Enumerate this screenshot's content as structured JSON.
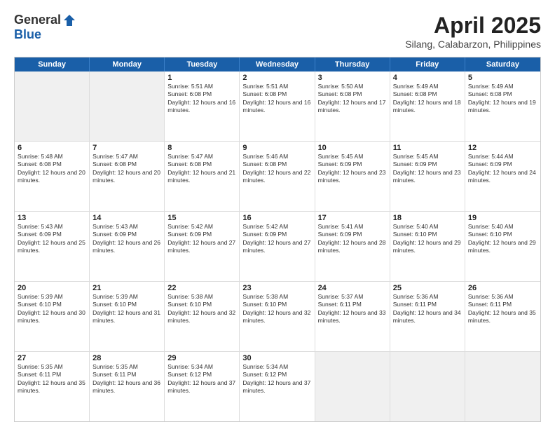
{
  "header": {
    "logo_general": "General",
    "logo_blue": "Blue",
    "month_title": "April 2025",
    "subtitle": "Silang, Calabarzon, Philippines"
  },
  "weekdays": [
    "Sunday",
    "Monday",
    "Tuesday",
    "Wednesday",
    "Thursday",
    "Friday",
    "Saturday"
  ],
  "rows": [
    [
      {
        "day": "",
        "info": ""
      },
      {
        "day": "",
        "info": ""
      },
      {
        "day": "1",
        "info": "Sunrise: 5:51 AM\nSunset: 6:08 PM\nDaylight: 12 hours and 16 minutes."
      },
      {
        "day": "2",
        "info": "Sunrise: 5:51 AM\nSunset: 6:08 PM\nDaylight: 12 hours and 16 minutes."
      },
      {
        "day": "3",
        "info": "Sunrise: 5:50 AM\nSunset: 6:08 PM\nDaylight: 12 hours and 17 minutes."
      },
      {
        "day": "4",
        "info": "Sunrise: 5:49 AM\nSunset: 6:08 PM\nDaylight: 12 hours and 18 minutes."
      },
      {
        "day": "5",
        "info": "Sunrise: 5:49 AM\nSunset: 6:08 PM\nDaylight: 12 hours and 19 minutes."
      }
    ],
    [
      {
        "day": "6",
        "info": "Sunrise: 5:48 AM\nSunset: 6:08 PM\nDaylight: 12 hours and 20 minutes."
      },
      {
        "day": "7",
        "info": "Sunrise: 5:47 AM\nSunset: 6:08 PM\nDaylight: 12 hours and 20 minutes."
      },
      {
        "day": "8",
        "info": "Sunrise: 5:47 AM\nSunset: 6:08 PM\nDaylight: 12 hours and 21 minutes."
      },
      {
        "day": "9",
        "info": "Sunrise: 5:46 AM\nSunset: 6:08 PM\nDaylight: 12 hours and 22 minutes."
      },
      {
        "day": "10",
        "info": "Sunrise: 5:45 AM\nSunset: 6:09 PM\nDaylight: 12 hours and 23 minutes."
      },
      {
        "day": "11",
        "info": "Sunrise: 5:45 AM\nSunset: 6:09 PM\nDaylight: 12 hours and 23 minutes."
      },
      {
        "day": "12",
        "info": "Sunrise: 5:44 AM\nSunset: 6:09 PM\nDaylight: 12 hours and 24 minutes."
      }
    ],
    [
      {
        "day": "13",
        "info": "Sunrise: 5:43 AM\nSunset: 6:09 PM\nDaylight: 12 hours and 25 minutes."
      },
      {
        "day": "14",
        "info": "Sunrise: 5:43 AM\nSunset: 6:09 PM\nDaylight: 12 hours and 26 minutes."
      },
      {
        "day": "15",
        "info": "Sunrise: 5:42 AM\nSunset: 6:09 PM\nDaylight: 12 hours and 27 minutes."
      },
      {
        "day": "16",
        "info": "Sunrise: 5:42 AM\nSunset: 6:09 PM\nDaylight: 12 hours and 27 minutes."
      },
      {
        "day": "17",
        "info": "Sunrise: 5:41 AM\nSunset: 6:09 PM\nDaylight: 12 hours and 28 minutes."
      },
      {
        "day": "18",
        "info": "Sunrise: 5:40 AM\nSunset: 6:10 PM\nDaylight: 12 hours and 29 minutes."
      },
      {
        "day": "19",
        "info": "Sunrise: 5:40 AM\nSunset: 6:10 PM\nDaylight: 12 hours and 29 minutes."
      }
    ],
    [
      {
        "day": "20",
        "info": "Sunrise: 5:39 AM\nSunset: 6:10 PM\nDaylight: 12 hours and 30 minutes."
      },
      {
        "day": "21",
        "info": "Sunrise: 5:39 AM\nSunset: 6:10 PM\nDaylight: 12 hours and 31 minutes."
      },
      {
        "day": "22",
        "info": "Sunrise: 5:38 AM\nSunset: 6:10 PM\nDaylight: 12 hours and 32 minutes."
      },
      {
        "day": "23",
        "info": "Sunrise: 5:38 AM\nSunset: 6:10 PM\nDaylight: 12 hours and 32 minutes."
      },
      {
        "day": "24",
        "info": "Sunrise: 5:37 AM\nSunset: 6:11 PM\nDaylight: 12 hours and 33 minutes."
      },
      {
        "day": "25",
        "info": "Sunrise: 5:36 AM\nSunset: 6:11 PM\nDaylight: 12 hours and 34 minutes."
      },
      {
        "day": "26",
        "info": "Sunrise: 5:36 AM\nSunset: 6:11 PM\nDaylight: 12 hours and 35 minutes."
      }
    ],
    [
      {
        "day": "27",
        "info": "Sunrise: 5:35 AM\nSunset: 6:11 PM\nDaylight: 12 hours and 35 minutes."
      },
      {
        "day": "28",
        "info": "Sunrise: 5:35 AM\nSunset: 6:11 PM\nDaylight: 12 hours and 36 minutes."
      },
      {
        "day": "29",
        "info": "Sunrise: 5:34 AM\nSunset: 6:12 PM\nDaylight: 12 hours and 37 minutes."
      },
      {
        "day": "30",
        "info": "Sunrise: 5:34 AM\nSunset: 6:12 PM\nDaylight: 12 hours and 37 minutes."
      },
      {
        "day": "",
        "info": ""
      },
      {
        "day": "",
        "info": ""
      },
      {
        "day": "",
        "info": ""
      }
    ]
  ]
}
